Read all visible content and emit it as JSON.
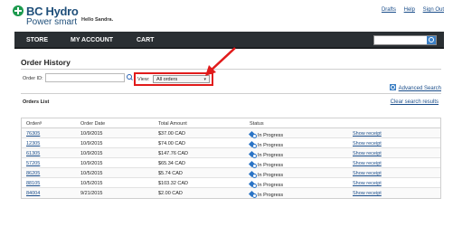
{
  "brand": {
    "name": "BC Hydro",
    "tagline": "Power smart"
  },
  "greeting": "Hello Sandra.",
  "top_links": [
    "Drafts",
    "Help",
    "Sign Out"
  ],
  "nav": {
    "items": [
      "STORE",
      "MY ACCOUNT",
      "CART"
    ],
    "search_placeholder": ""
  },
  "page": {
    "title": "Order History",
    "order_id_label": "Order ID:",
    "order_id_value": "",
    "view_label": "View:",
    "view_selected": "All orders",
    "advanced_search": "Advanced Search",
    "orders_list_label": "Orders List",
    "clear_search": "Clear search results"
  },
  "table": {
    "headers": [
      "Order#",
      "Order Date",
      "Total Amount",
      "Status",
      ""
    ],
    "rows": [
      {
        "order": "76305",
        "date": "10/9/2015",
        "amount": "$37.00 CAD",
        "status": "In Progress",
        "action": "Show receipt"
      },
      {
        "order": "12305",
        "date": "10/9/2015",
        "amount": "$74.00 CAD",
        "status": "In Progress",
        "action": "Show receipt"
      },
      {
        "order": "61305",
        "date": "10/9/2015",
        "amount": "$147.76 CAD",
        "status": "In Progress",
        "action": "Show receipt"
      },
      {
        "order": "57205",
        "date": "10/9/2015",
        "amount": "$65.34 CAD",
        "status": "In Progress",
        "action": "Show receipt"
      },
      {
        "order": "86205",
        "date": "10/5/2015",
        "amount": "$5.74 CAD",
        "status": "In Progress",
        "action": "Show receipt"
      },
      {
        "order": "88105",
        "date": "10/5/2015",
        "amount": "$103.32 CAD",
        "status": "In Progress",
        "action": "Show receipt"
      },
      {
        "order": "84004",
        "date": "9/21/2015",
        "amount": "$2.00 CAD",
        "status": "In Progress",
        "action": "Show receipt"
      }
    ]
  },
  "colors": {
    "nav_bg": "#2a2f33",
    "brand_blue": "#1f4f7a",
    "link": "#1a4d8a",
    "highlight": "#e11b1b",
    "brand_green": "#1c9a4e"
  }
}
